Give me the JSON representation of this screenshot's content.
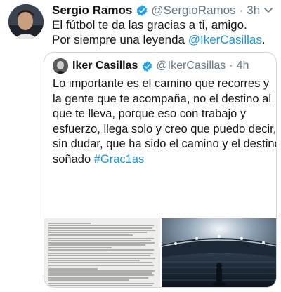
{
  "tweet": {
    "author_name": "Sergio Ramos",
    "handle": "@SergioRamos",
    "separator": "·",
    "time": "3h",
    "text_line1": "El fútbol te da las gracias a ti, amigo.",
    "text_line2_prefix": "Por siempre una leyenda ",
    "mention": "@IkerCasillas",
    "mention_suffix": "."
  },
  "quoted_tweet": {
    "author_name": "Iker Casillas",
    "handle": "@IkerCasillas",
    "separator": "·",
    "time": "4h",
    "lines": [
      "Lo importante es el camino que recorres y",
      "la gente que te acompaña, no el destino al",
      "que te lleva, porque eso con trabajo y",
      "esfuerzo, llega solo y creo que puedo decir,",
      "sin dudar, que ha sido el camino y el destino",
      "soñado #Grac1as"
    ]
  },
  "media": [
    {
      "icon": "letter-document-image"
    },
    {
      "icon": "stadium-photo-image"
    }
  ],
  "colors": {
    "link": "#1b95e0",
    "verified": "#1da1f2",
    "secondary_text": "#657786",
    "border": "#ccd6dd"
  }
}
